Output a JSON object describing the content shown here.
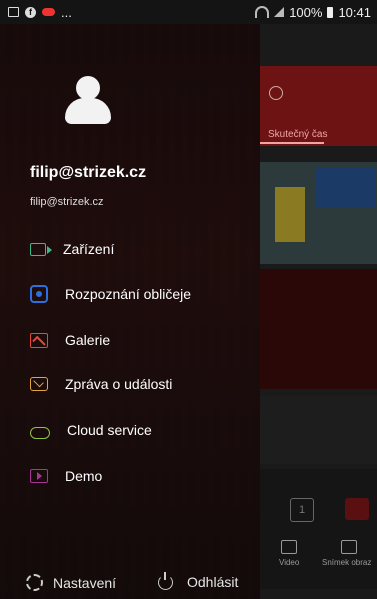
{
  "status_bar": {
    "left_text": "...",
    "battery": "100%",
    "time": "10:41"
  },
  "background_app": {
    "tab_label": "Skutečný čas",
    "bottom_buttons": [
      {
        "label": "Video",
        "icon": "video-icon"
      },
      {
        "label": "Snímek obraz",
        "icon": "snapshot-icon"
      }
    ]
  },
  "drawer": {
    "user": {
      "name": "filip@strizek.cz",
      "email": "filip@strizek.cz"
    },
    "menu": [
      {
        "label": "Zařízení",
        "icon": "camera-icon",
        "color": "#3cb88c"
      },
      {
        "label": "Rozpoznání obličeje",
        "icon": "face-recognition-icon",
        "color": "#2b6fe0"
      },
      {
        "label": "Galerie",
        "icon": "gallery-icon",
        "color": "#e04a3c"
      },
      {
        "label": "Zpráva o události",
        "icon": "message-icon",
        "color": "#e7a43a"
      },
      {
        "label": "Cloud service",
        "icon": "cloud-icon",
        "color": "#8dc63f"
      },
      {
        "label": "Demo",
        "icon": "demo-icon",
        "color": "#a8349a"
      }
    ],
    "footer": {
      "settings": "Nastavení",
      "logout": "Odhlásit"
    }
  }
}
